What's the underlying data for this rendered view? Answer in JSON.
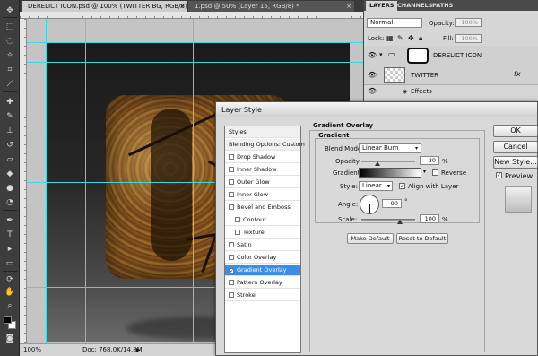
{
  "tabs": {
    "active": "DERELICT ICON.psd @ 100% (TWITTER BG, RGB/8) *",
    "inactive": "1.psd @ 50% (Layer 15, RGB/8) *",
    "close": "×"
  },
  "status": {
    "zoom": "100%",
    "doc": "Doc: 768.0K/14.8M",
    "arrow": "▶"
  },
  "layers_panel": {
    "tabs": [
      "LAYERS",
      "CHANNELS",
      "PATHS"
    ],
    "blend_mode": "Normal",
    "opacity_label": "Opacity:",
    "opacity_value": "100%",
    "lock_label": "Lock:",
    "fill_label": "Fill:",
    "fill_value": "100%",
    "layers": [
      {
        "name": "DERELICT ICON"
      },
      {
        "name": "TWITTER",
        "fx": "fx"
      },
      {
        "name": "Effects"
      }
    ]
  },
  "dialog": {
    "title": "Layer Style",
    "styles_header": "Styles",
    "blending_options": "Blending Options: Custom",
    "items": [
      {
        "label": "Drop Shadow"
      },
      {
        "label": "Inner Shadow"
      },
      {
        "label": "Outer Glow"
      },
      {
        "label": "Inner Glow"
      },
      {
        "label": "Bevel and Emboss"
      },
      {
        "label": "Contour"
      },
      {
        "label": "Texture"
      },
      {
        "label": "Satin"
      },
      {
        "label": "Color Overlay"
      },
      {
        "label": "Gradient Overlay"
      },
      {
        "label": "Pattern Overlay"
      },
      {
        "label": "Stroke"
      }
    ],
    "section_title": "Gradient Overlay",
    "subsection_title": "Gradient",
    "blend_mode_label": "Blend Mode:",
    "blend_mode_value": "Linear Burn",
    "opacity_label": "Opacity:",
    "opacity_value": "30",
    "percent": "%",
    "gradient_label": "Gradient:",
    "reverse_label": "Reverse",
    "style_label": "Style:",
    "style_value": "Linear",
    "align_label": "Align with Layer",
    "angle_label": "Angle:",
    "angle_value": "-90",
    "degree": "°",
    "scale_label": "Scale:",
    "scale_value": "100",
    "make_default": "Make Default",
    "reset_default": "Reset to Default",
    "ok": "OK",
    "cancel": "Cancel",
    "new_style": "New Style...",
    "preview": "Preview"
  },
  "colors": {
    "selected": "#3b8ee8",
    "guide": "#40d8e0"
  }
}
